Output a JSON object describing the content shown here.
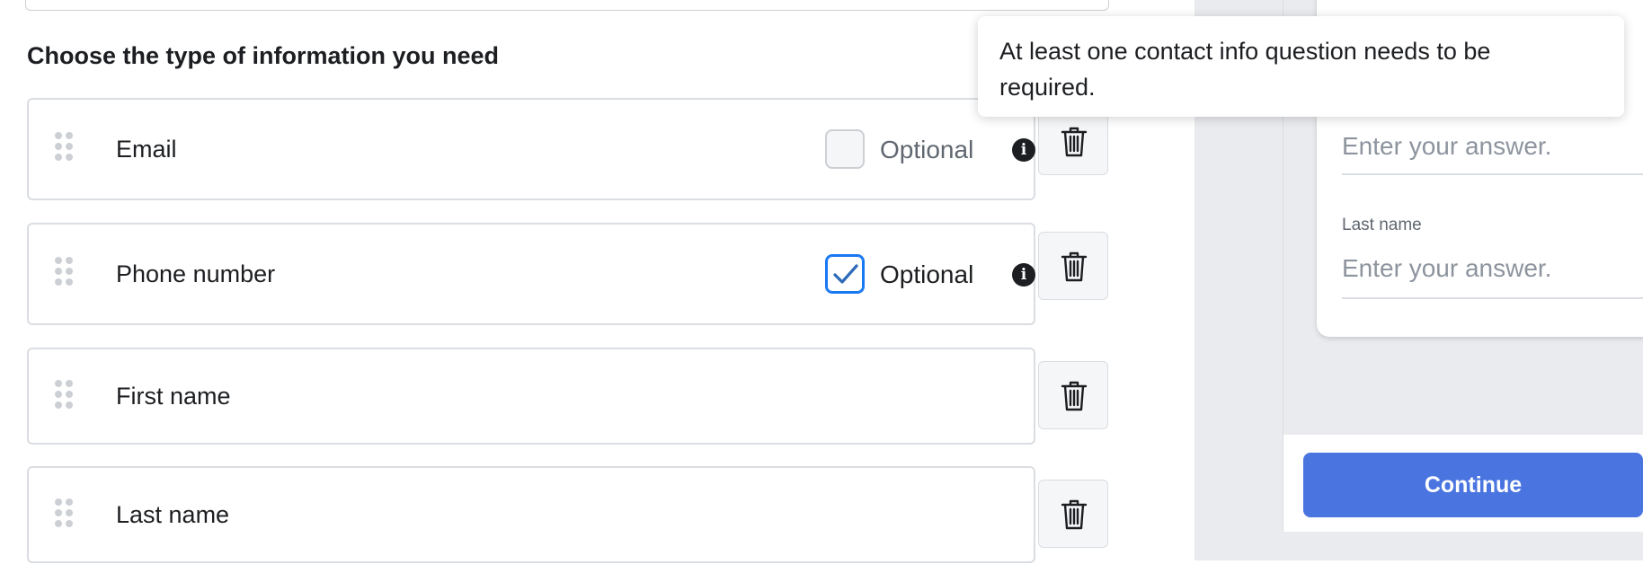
{
  "section_title": "Choose the type of information you need",
  "rows": [
    {
      "label": "Email",
      "optional_label": "Optional",
      "optional_checked": false
    },
    {
      "label": "Phone number",
      "optional_label": "Optional",
      "optional_checked": true
    },
    {
      "label": "First name"
    },
    {
      "label": "Last name"
    }
  ],
  "tooltip": {
    "text": "At least one contact info question needs to be required."
  },
  "preview": {
    "fields": [
      {
        "label": "",
        "placeholder": "Enter your answer."
      },
      {
        "label": "Last name",
        "placeholder": "Enter your answer."
      }
    ],
    "continue_label": "Continue"
  },
  "colors": {
    "accent": "#1877f2",
    "continue_button": "#4a74e0",
    "preview_background": "#e9ebee"
  },
  "icons": [
    "drag-handle-icon",
    "check-icon",
    "info-icon",
    "trash-icon"
  ]
}
